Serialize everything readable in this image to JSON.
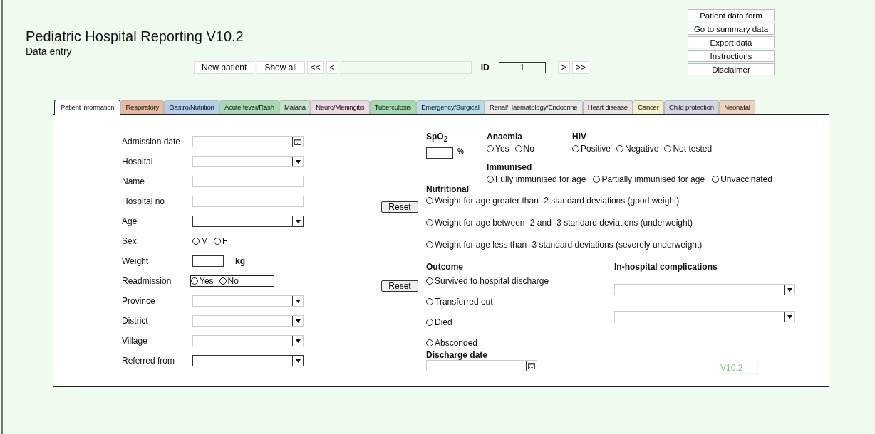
{
  "header": {
    "title": "Pediatric Hospital Reporting V10.2",
    "subtitle": "Data entry"
  },
  "nav_buttons": [
    "Patient data form",
    "Go to summary data",
    "Export data",
    "Instructions",
    "Disclaimer"
  ],
  "record_nav": {
    "new_patient": "New patient",
    "show_all": "Show all",
    "first": "<<",
    "prev": "<",
    "id_label": "ID",
    "id_value": "1",
    "next": ">",
    "last": ">>"
  },
  "tabs": [
    {
      "label": "Patient information",
      "selected": true,
      "color": "#ffffff"
    },
    {
      "label": "Respiratory",
      "selected": false,
      "color": "#e9b9a2"
    },
    {
      "label": "Gastro/Nutrition",
      "selected": false,
      "color": "#b3cfea"
    },
    {
      "label": "Acute fever/Rash",
      "selected": false,
      "color": "#a9d9b3"
    },
    {
      "label": "Malaria",
      "selected": false,
      "color": "#c5e2cd"
    },
    {
      "label": "Neuro/Meningitis",
      "selected": false,
      "color": "#ecd9e1"
    },
    {
      "label": "Tuberculosis",
      "selected": false,
      "color": "#a2dcb2"
    },
    {
      "label": "Emergency/Surgical",
      "selected": false,
      "color": "#b8dceb"
    },
    {
      "label": "Renal/Haematology/Endocrine",
      "selected": false,
      "color": "#e9e9e9"
    },
    {
      "label": "Heart disease",
      "selected": false,
      "color": "#e9e2e2"
    },
    {
      "label": "Cancer",
      "selected": false,
      "color": "#f1f1cb"
    },
    {
      "label": "Child protection",
      "selected": false,
      "color": "#d5d5e5"
    },
    {
      "label": "Neonatal",
      "selected": false,
      "color": "#edd2c2"
    }
  ],
  "patient_fields": [
    {
      "label": "Admission date",
      "kind": "date"
    },
    {
      "label": "Hospital",
      "kind": "select"
    },
    {
      "label": "Name",
      "kind": "text"
    },
    {
      "label": "Hospital no",
      "kind": "text"
    },
    {
      "label": "Age",
      "kind": "select"
    },
    {
      "label": "Sex",
      "kind": "radio",
      "options": [
        {
          "label": "M",
          "selected": false
        },
        {
          "label": "F",
          "selected": false
        }
      ]
    },
    {
      "label": "Weight",
      "kind": "number",
      "unit": "kg"
    },
    {
      "label": "Readmission",
      "kind": "radio-framed",
      "options": [
        {
          "label": "Yes",
          "selected": false
        },
        {
          "label": "No",
          "selected": false
        }
      ]
    },
    {
      "label": "Province",
      "kind": "select"
    },
    {
      "label": "District",
      "kind": "select"
    },
    {
      "label": "Village",
      "kind": "select"
    },
    {
      "label": "Referred from",
      "kind": "select"
    }
  ],
  "spo2": {
    "label": "SpO$_{2}$",
    "unit": "%"
  },
  "anaemia": {
    "label": "Anaemia",
    "options": [
      {
        "label": "Yes",
        "selected": false
      },
      {
        "label": "No",
        "selected": false
      }
    ]
  },
  "hiv": {
    "label": "HIV",
    "options": [
      {
        "label": "Positive",
        "selected": false
      },
      {
        "label": "Negative",
        "selected": false
      },
      {
        "label": "Not tested",
        "selected": false
      }
    ]
  },
  "immunised": {
    "label": "Immunised",
    "options": [
      {
        "label": "Fully immunised for age",
        "selected": false
      },
      {
        "label": "Partially immunised for age",
        "selected": false
      },
      {
        "label": "Unvaccinated",
        "selected": false
      }
    ]
  },
  "nutritional": {
    "label": "Nutritional",
    "reset": "Reset",
    "options": [
      {
        "label": "Weight for age greater than -2 standard deviations (good weight)",
        "selected": false
      },
      {
        "label": "Weight for age between -2 and -3 standard deviations (underweight)",
        "selected": false
      },
      {
        "label": "Weight for age less than -3 standard deviations (severely underweight)",
        "selected": false
      }
    ]
  },
  "outcome": {
    "label": "Outcome",
    "reset": "Reset",
    "options": [
      {
        "label": "Survived to hospital discharge",
        "selected": false
      },
      {
        "label": "Transferred out",
        "selected": false
      },
      {
        "label": "Died",
        "selected": false
      },
      {
        "label": "Absconded",
        "selected": false
      }
    ]
  },
  "complications": {
    "label": "In-hospital complications",
    "fields": [
      {
        "kind": "select"
      },
      {
        "kind": "select"
      }
    ]
  },
  "discharge_date": {
    "label": "Discharge date"
  },
  "version_label": "V10.2"
}
